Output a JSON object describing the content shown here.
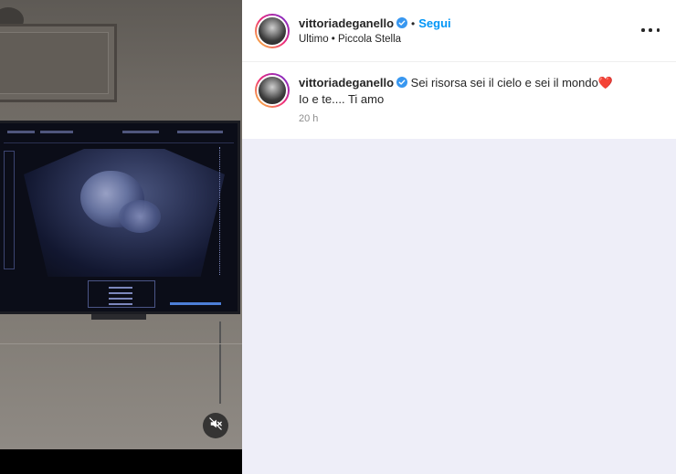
{
  "post": {
    "username": "vittoriadeganello",
    "dot": "•",
    "follow_label": "Segui",
    "subtitle": "Ultimo • Piccola Stella",
    "more_icon": "more-horizontal-icon"
  },
  "caption": {
    "username": "vittoriadeganello",
    "text_line1": "Sei risorsa sei il cielo e sei il mondo",
    "emoji": "❤️",
    "text_line2": "Io e te.... Ti amo",
    "time": "20 h"
  },
  "media": {
    "mute_icon": "muted-speaker-icon"
  },
  "colors": {
    "link_blue": "#0095f6",
    "verified_blue": "#3897f0",
    "panel_bg": "#eeeef8",
    "heart_red": "#e0192c"
  }
}
